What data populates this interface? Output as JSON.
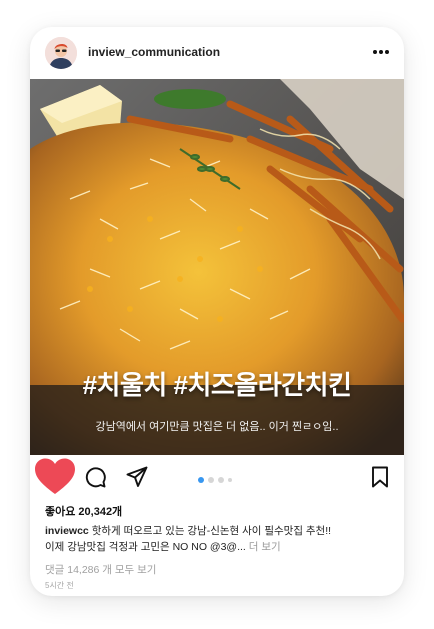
{
  "post": {
    "username": "inview_communication",
    "hashtag_overlay": "#치울치 #치즈올라간치킨",
    "image_caption": "강남역에서 여기만큼 맛집은 더 없음.. 이거 찐ㄹㅇ임..",
    "likes": "좋아요 20,342개",
    "caption_user": "inviewcc",
    "caption_line1": "핫하게 떠오르고 있는 강남-신논현 사이 필수맛집 추천!!",
    "caption_line2": "이제 강남맛집 걱정과 고민은 NO NO @3@...",
    "more_label": "더 보기",
    "comments": "댓글 14,286 개 모두 보기",
    "time_ago": "5시간 전"
  },
  "carousel": {
    "count": 4,
    "active": 0
  },
  "icons": {
    "more": "more-horizontal-icon",
    "like": "heart-icon",
    "comment": "comment-icon",
    "share": "send-icon",
    "save": "bookmark-icon"
  },
  "colors": {
    "like": "#ed4956",
    "active_dot": "#3897f0",
    "inactive_dot": "#d6d6d6"
  }
}
